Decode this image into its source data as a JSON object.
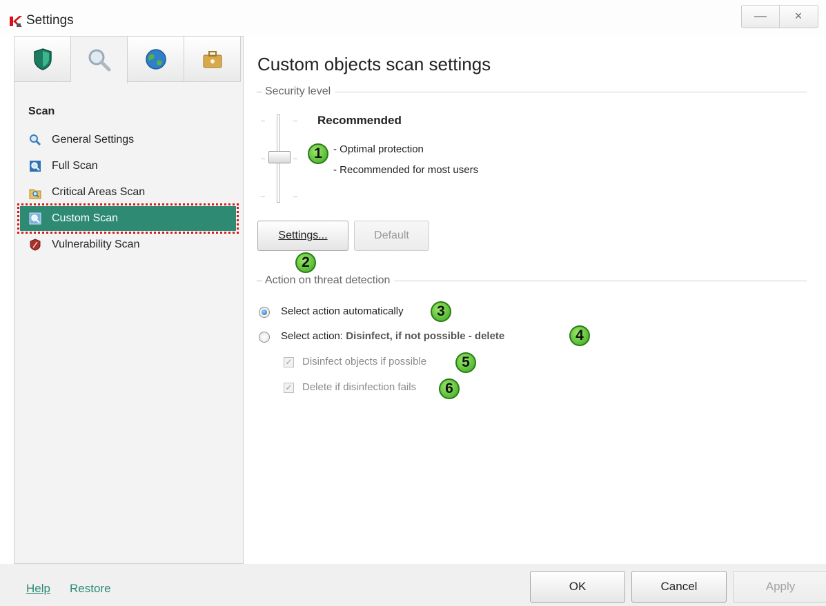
{
  "window": {
    "title": "Settings",
    "minimize_glyph": "—",
    "close_glyph": "×"
  },
  "tabs": [
    {
      "icon": "shield-icon"
    },
    {
      "icon": "magnifier-icon",
      "active": true
    },
    {
      "icon": "globe-icon"
    },
    {
      "icon": "toolbox-icon"
    }
  ],
  "sidebar": {
    "heading": "Scan",
    "items": [
      {
        "label": "General Settings",
        "icon": "magnifier-icon"
      },
      {
        "label": "Full Scan",
        "icon": "full-scan-icon"
      },
      {
        "label": "Critical Areas Scan",
        "icon": "critical-areas-icon"
      },
      {
        "label": "Custom Scan",
        "icon": "custom-scan-icon",
        "selected": true
      },
      {
        "label": "Vulnerability Scan",
        "icon": "vulnerability-icon"
      }
    ]
  },
  "main": {
    "title": "Custom objects scan settings",
    "security_section": "Security level",
    "level_name": "Recommended",
    "level_desc": [
      "- Optimal protection",
      "- Recommended for most users"
    ],
    "settings_button": "Settings...",
    "default_button": "Default",
    "action_section": "Action on threat detection",
    "radio_auto": "Select action automatically",
    "radio_select": "Select action:",
    "radio_select_value": "Disinfect, if not possible - delete",
    "check_disinfect": "Disinfect objects if possible",
    "check_delete": "Delete if disinfection fails"
  },
  "badges": [
    "1",
    "2",
    "3",
    "4",
    "5",
    "6"
  ],
  "footer": {
    "help": "Help",
    "restore": "Restore",
    "ok": "OK",
    "cancel": "Cancel",
    "apply": "Apply"
  },
  "colors": {
    "accent": "#2e8a73",
    "selection_outline": "#d61a1a",
    "badge_green": "#39a81f"
  }
}
